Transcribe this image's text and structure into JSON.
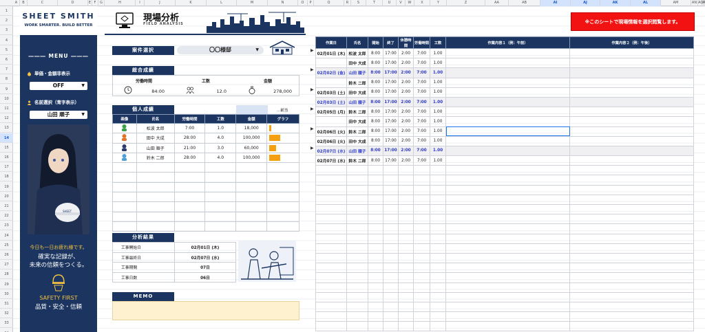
{
  "columns": [
    "A",
    "B",
    "C",
    "D",
    "E",
    "F",
    "G",
    "H",
    "I",
    "J",
    "K",
    "L",
    "M",
    "N",
    "O",
    "P",
    "Q",
    "R",
    "S",
    "T",
    "U",
    "V",
    "W",
    "X",
    "Y",
    "Z",
    "AA",
    "AB",
    "AI",
    "AJ",
    "AK",
    "AL",
    "AM",
    "AN",
    "AO",
    "AP",
    "AQ"
  ],
  "rows": [
    "1",
    "2",
    "3",
    "4",
    "5",
    "6",
    "7",
    "8",
    "9",
    "10",
    "11",
    "12",
    "13",
    "14",
    "15",
    "16",
    "17",
    "18",
    "19",
    "20",
    "21",
    "22",
    "23",
    "24",
    "25",
    "26",
    "27",
    "28",
    "29",
    "30",
    "31",
    "32",
    "33",
    "34"
  ],
  "selected_row": "14",
  "sidebar": {
    "brand": "SHEET SMITH",
    "tagline": "WORK SMARTER. BUILD BETTER",
    "menu_title": "――― MENU ―――",
    "price_toggle_label": "単価・金額非表示",
    "price_toggle_value": "OFF",
    "name_select_label": "名前選択（青字表示）",
    "name_select_value": "山田 順子",
    "quote_small": "今日も一日お疲れ様です。",
    "quote_big": [
      "確実な記録が、",
      "未来の信頼をつくる。"
    ],
    "safety_title": "SAFETY FIRST",
    "safety_sub": "品質・安全・信頼"
  },
  "main": {
    "title": "現場分析",
    "subtitle": "FIELD ANALYSIS",
    "case_label": "案件選択",
    "case_value": "〇〇様邸",
    "overall_label": "総合成績",
    "overall": {
      "hours_label": "労働時間",
      "hours_value": "84:00",
      "units_label": "工数",
      "units_value": "12.0",
      "amount_label": "金額",
      "amount_value": "278,000"
    },
    "personal_label": "個人成績",
    "personal_extra": "...前当",
    "personal_headers": [
      "画像",
      "氏名",
      "労働時間",
      "工数",
      "金額",
      "グラフ"
    ],
    "personal_rows": [
      {
        "name": "松波 太郎",
        "hours": "7:00",
        "units": "1.0",
        "amount": "18,000",
        "ratio": 0.18
      },
      {
        "name": "田中 大成",
        "hours": "28:00",
        "units": "4.0",
        "amount": "100,000",
        "ratio": 1.0
      },
      {
        "name": "山田 順子",
        "hours": "21:00",
        "units": "3.0",
        "amount": "60,000",
        "ratio": 0.6
      },
      {
        "name": "鈴木 二郎",
        "hours": "28:00",
        "units": "4.0",
        "amount": "100,000",
        "ratio": 1.0
      }
    ],
    "analysis_label": "分析結果",
    "analysis_rows": [
      {
        "label": "工事開始日",
        "value": "02月01日 (木)"
      },
      {
        "label": "工事最終日",
        "value": "02月07日 (水)"
      },
      {
        "label": "工事期間",
        "value": "07日"
      },
      {
        "label": "工事日数",
        "value": "06日"
      }
    ],
    "memo_label": "MEMO"
  },
  "right": {
    "alert": "※このシートで現場情報を選択閲覧します。",
    "headers": [
      "作業日",
      "氏名",
      "開始",
      "終了",
      "休憩時間",
      "労働時間",
      "工数",
      "作業内容１（例：午前）",
      "作業内容２（例：午後）"
    ],
    "rows": [
      {
        "date": "02月01日 (木)",
        "name": "松波 太郎",
        "start": "8:00",
        "end": "17:00",
        "break": "2:00",
        "work": "7:00",
        "units": "1.00",
        "marker": true,
        "hl": false
      },
      {
        "date": "",
        "name": "田中 大成",
        "start": "8:00",
        "end": "17:00",
        "break": "2:00",
        "work": "7:00",
        "units": "1.00",
        "marker": false,
        "hl": false
      },
      {
        "date": "02月02日 (金)",
        "name": "山田 順子",
        "start": "8:00",
        "end": "17:00",
        "break": "2:00",
        "work": "7:00",
        "units": "1.00",
        "marker": true,
        "hl": true
      },
      {
        "date": "",
        "name": "鈴木 二郎",
        "start": "8:00",
        "end": "17:00",
        "break": "2:00",
        "work": "7:00",
        "units": "1.00",
        "marker": false,
        "hl": false
      },
      {
        "date": "02月03日 (土)",
        "name": "田中 大成",
        "start": "8:00",
        "end": "17:00",
        "break": "2:00",
        "work": "7:00",
        "units": "1.00",
        "marker": true,
        "hl": false
      },
      {
        "date": "02月03日 (土)",
        "name": "山田 順子",
        "start": "8:00",
        "end": "17:00",
        "break": "2:00",
        "work": "7:00",
        "units": "1.00",
        "marker": false,
        "hl": true
      },
      {
        "date": "02月05日 (月)",
        "name": "鈴木 二郎",
        "start": "8:00",
        "end": "17:00",
        "break": "2:00",
        "work": "7:00",
        "units": "1.00",
        "marker": true,
        "hl": false
      },
      {
        "date": "",
        "name": "田中 大成",
        "start": "8:00",
        "end": "17:00",
        "break": "2:00",
        "work": "7:00",
        "units": "1.00",
        "marker": false,
        "hl": false
      },
      {
        "date": "02月06日 (火)",
        "name": "鈴木 二郎",
        "start": "8:00",
        "end": "17:00",
        "break": "2:00",
        "work": "7:00",
        "units": "1.00",
        "marker": true,
        "hl": false
      },
      {
        "date": "02月06日 (火)",
        "name": "田中 大成",
        "start": "8:00",
        "end": "17:00",
        "break": "2:00",
        "work": "7:00",
        "units": "1.00",
        "marker": false,
        "hl": false
      },
      {
        "date": "02月07日 (水)",
        "name": "山田 順子",
        "start": "8:00",
        "end": "17:00",
        "break": "2:00",
        "work": "7:00",
        "units": "1.00",
        "marker": true,
        "hl": true
      },
      {
        "date": "02月07日 (水)",
        "name": "鈴木 二郎",
        "start": "8:00",
        "end": "17:00",
        "break": "2:00",
        "work": "7:00",
        "units": "1.00",
        "marker": false,
        "hl": false
      }
    ],
    "empty_rows": 17
  },
  "colors": {
    "navy": "#1b3560",
    "orange": "#f5a011",
    "alert_red": "#f31212",
    "highlight_text": "#2d3ac9",
    "memo_bg": "#fdf1cf"
  }
}
